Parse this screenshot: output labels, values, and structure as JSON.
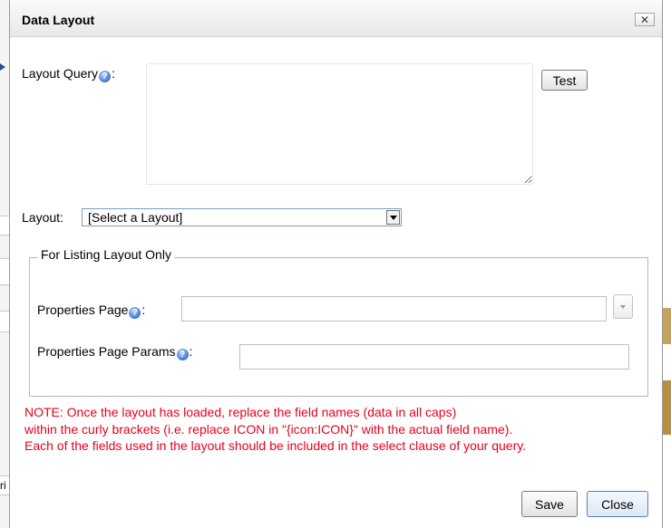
{
  "dialog": {
    "title": "Data Layout",
    "close_glyph": "✕"
  },
  "layout_query": {
    "label": "Layout Query",
    "colon": ":",
    "value": "",
    "help_icon": "help-icon",
    "test_button": "Test"
  },
  "layout": {
    "label": "Layout:",
    "selected": "[Select a Layout]"
  },
  "listing_group": {
    "legend": "For Listing Layout Only",
    "properties_page": {
      "label": "Properties Page",
      "colon": ":",
      "value": ""
    },
    "properties_page_params": {
      "label": "Properties Page Params",
      "colon": ":",
      "value": ""
    }
  },
  "note": {
    "lines": [
      "NOTE: Once the layout has loaded, replace the field names (data in all caps)",
      "within the curly brackets (i.e. replace ICON in \"{icon:ICON}\" with the actual field name).",
      "Each of the fields used in the layout should be included in the select clause of your query."
    ]
  },
  "footer": {
    "save_label": "Save",
    "close_label": "Close"
  },
  "background": {
    "fragment_text": "ri"
  },
  "colors": {
    "note_red": "#e8001c",
    "help_blue": "#3d72d6"
  }
}
